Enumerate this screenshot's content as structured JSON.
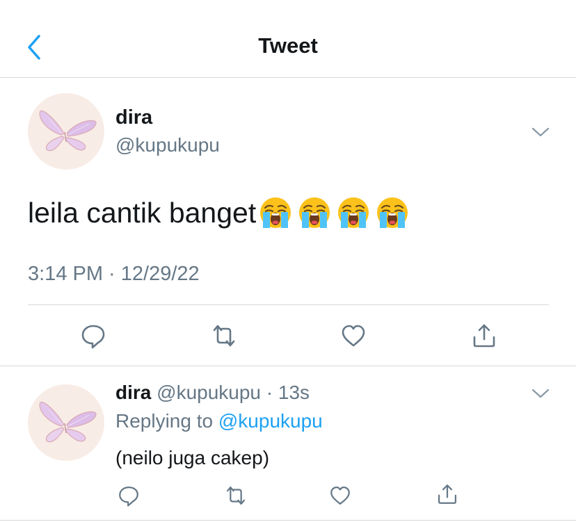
{
  "header": {
    "title": "Tweet",
    "back_icon": "chevron-left-icon"
  },
  "main_tweet": {
    "display_name": "dira",
    "handle": "@kupukupu",
    "text": "leila cantik banget",
    "emojis": [
      "loudly-crying-face",
      "loudly-crying-face",
      "loudly-crying-face",
      "loudly-crying-face"
    ],
    "timestamp": "3:14 PM · 12/29/22",
    "actions": [
      "reply-icon",
      "retweet-icon",
      "like-icon",
      "share-icon"
    ]
  },
  "reply_tweet": {
    "display_name": "dira",
    "meta": "@kupukupu · 13s",
    "replying_prefix": "Replying to ",
    "replying_handle": "@kupukupu",
    "text": "(neilo juga cakep)",
    "actions": [
      "reply-icon",
      "retweet-icon",
      "like-icon",
      "share-icon"
    ]
  },
  "colors": {
    "accent": "#1da1f2",
    "secondary_text": "#657786",
    "divider": "#d4d8dc",
    "avatar_bg": "#f8ece6"
  }
}
